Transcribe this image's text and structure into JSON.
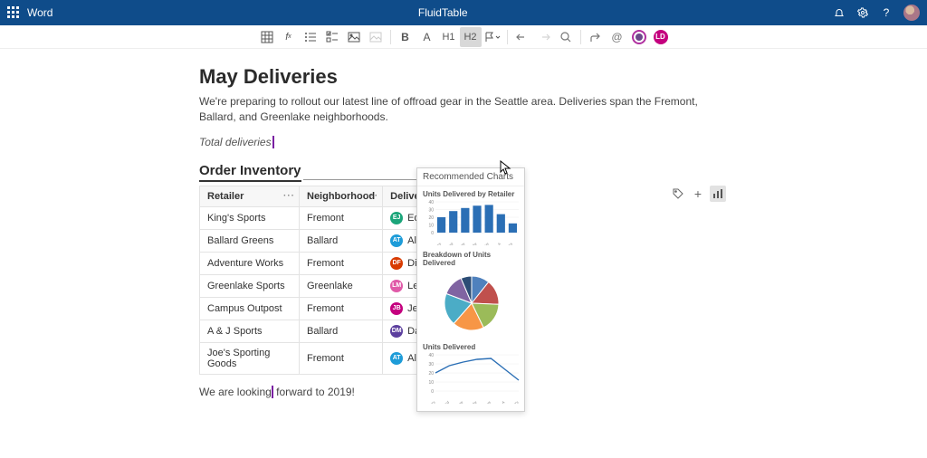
{
  "app": {
    "name": "Word",
    "docTitle": "FluidTable"
  },
  "toolbar": {
    "bold": "B",
    "a": "A",
    "h1": "H1",
    "h2": "H2"
  },
  "doc": {
    "title": "May Deliveries",
    "intro": "We're preparing to rollout our latest line of offroad gear in the Seattle area. Deliveries span the Fremont, Ballard, and Greenlake neighborhoods.",
    "totalLabel": "Total deliveries",
    "sectionTitle": "Order Inventory",
    "closing_a": "We are looking",
    "closing_b": "forward to 2019!"
  },
  "table": {
    "headers": {
      "retailer": "Retailer",
      "neighborhood": "Neighborhood",
      "carrier": "Delivery Carrier"
    },
    "rows": [
      {
        "retailer": "King's Sports",
        "neighborhood": "Fremont",
        "carrier": "Edward Johns",
        "initials": "EJ",
        "color": "#1ba57a",
        "x": false
      },
      {
        "retailer": "Ballard Greens",
        "neighborhood": "Ballard",
        "carrier": "Alisha Todd",
        "initials": "AT",
        "color": "#1e9cd8",
        "x": true
      },
      {
        "retailer": "Adventure Works",
        "neighborhood": "Fremont",
        "carrier": "Diana Ford",
        "initials": "DF",
        "color": "#d83b01",
        "x": true
      },
      {
        "retailer": "Greenlake Sports",
        "neighborhood": "Greenlake",
        "carrier": "Leonard B. Ma",
        "initials": "LM",
        "color": "#e05aa8",
        "x": false
      },
      {
        "retailer": "Campus Outpost",
        "neighborhood": "Fremont",
        "carrier": "Jenaro Botello",
        "initials": "JB",
        "color": "#c4007e",
        "x": false
      },
      {
        "retailer": "A & J Sports",
        "neighborhood": "Ballard",
        "carrier": "Daniela Moren",
        "initials": "DM",
        "color": "#5c3f9e",
        "x": false
      },
      {
        "retailer": "Joe's Sporting Goods",
        "neighborhood": "Fremont",
        "carrier": "Alisha Todd",
        "initials": "AT",
        "color": "#1e9cd8",
        "x": true
      }
    ]
  },
  "recPanel": {
    "title": "Recommended Charts",
    "chart1": "Units Delivered by Retailer",
    "chart2": "Breakdown of Units Delivered",
    "chart3": "Units Delivered"
  },
  "chart_data": [
    {
      "type": "bar",
      "title": "Units Delivered by Retailer",
      "ylabel": "",
      "xlabel": "",
      "ylim": [
        0,
        40
      ],
      "yticks": [
        0,
        10,
        20,
        30,
        40
      ],
      "categories": [
        "King's Sports",
        "Ballard Greens",
        "Adventure Works",
        "Greenlake Sports",
        "Campus Outpost",
        "A & J Sports",
        "Joe's Sporting Goods"
      ],
      "values": [
        20,
        28,
        32,
        35,
        36,
        24,
        12
      ],
      "series_color": "#2b6fb5"
    },
    {
      "type": "pie",
      "title": "Breakdown of Units Delivered",
      "categories": [
        "King's Sports",
        "Ballard Greens",
        "Adventure Works",
        "Greenlake Sports",
        "Campus Outpost",
        "A & J Sports",
        "Joe's Sporting Goods"
      ],
      "values": [
        20,
        28,
        32,
        35,
        36,
        24,
        12
      ],
      "colors": [
        "#4f81bd",
        "#c0504d",
        "#9bbb59",
        "#f79646",
        "#4bacc6",
        "#8064a2",
        "#2c4d75"
      ]
    },
    {
      "type": "line",
      "title": "Units Delivered",
      "ylim": [
        0,
        40
      ],
      "yticks": [
        0,
        10,
        20,
        30,
        40
      ],
      "categories": [
        "King's Sports",
        "Ballard Greens",
        "Adventure Works",
        "Greenlake Sports",
        "Campus Outpost",
        "A & J Sports",
        "Joe's Sporting Goods"
      ],
      "values": [
        20,
        28,
        32,
        35,
        36,
        24,
        12
      ],
      "series_color": "#2b6fb5"
    }
  ]
}
